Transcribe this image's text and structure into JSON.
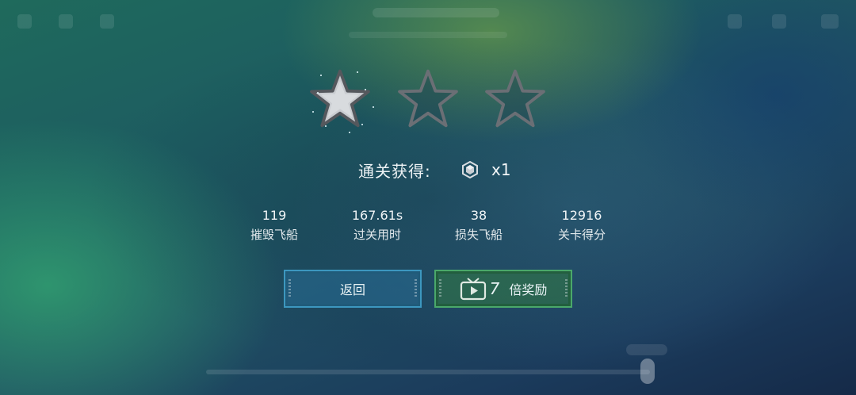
{
  "reward": {
    "label": "通关获得:",
    "icon": "hexagon-gem-icon",
    "count": "x1"
  },
  "stars": {
    "earned": 1,
    "total": 3
  },
  "stats": [
    {
      "value": "119",
      "label": "摧毁飞船"
    },
    {
      "value": "167.61s",
      "label": "过关用时"
    },
    {
      "value": "38",
      "label": "损失飞船"
    },
    {
      "value": "12916",
      "label": "关卡得分"
    }
  ],
  "buttons": {
    "back_label": "返回",
    "double_icon": "tv-ad-icon",
    "double_multiplier": "7",
    "double_label": "倍奖励"
  },
  "colors": {
    "back_button": "#3c97bf",
    "double_button": "#4aa86a",
    "star_earned": "#c9ccd0",
    "star_empty": "#6b6f75"
  }
}
